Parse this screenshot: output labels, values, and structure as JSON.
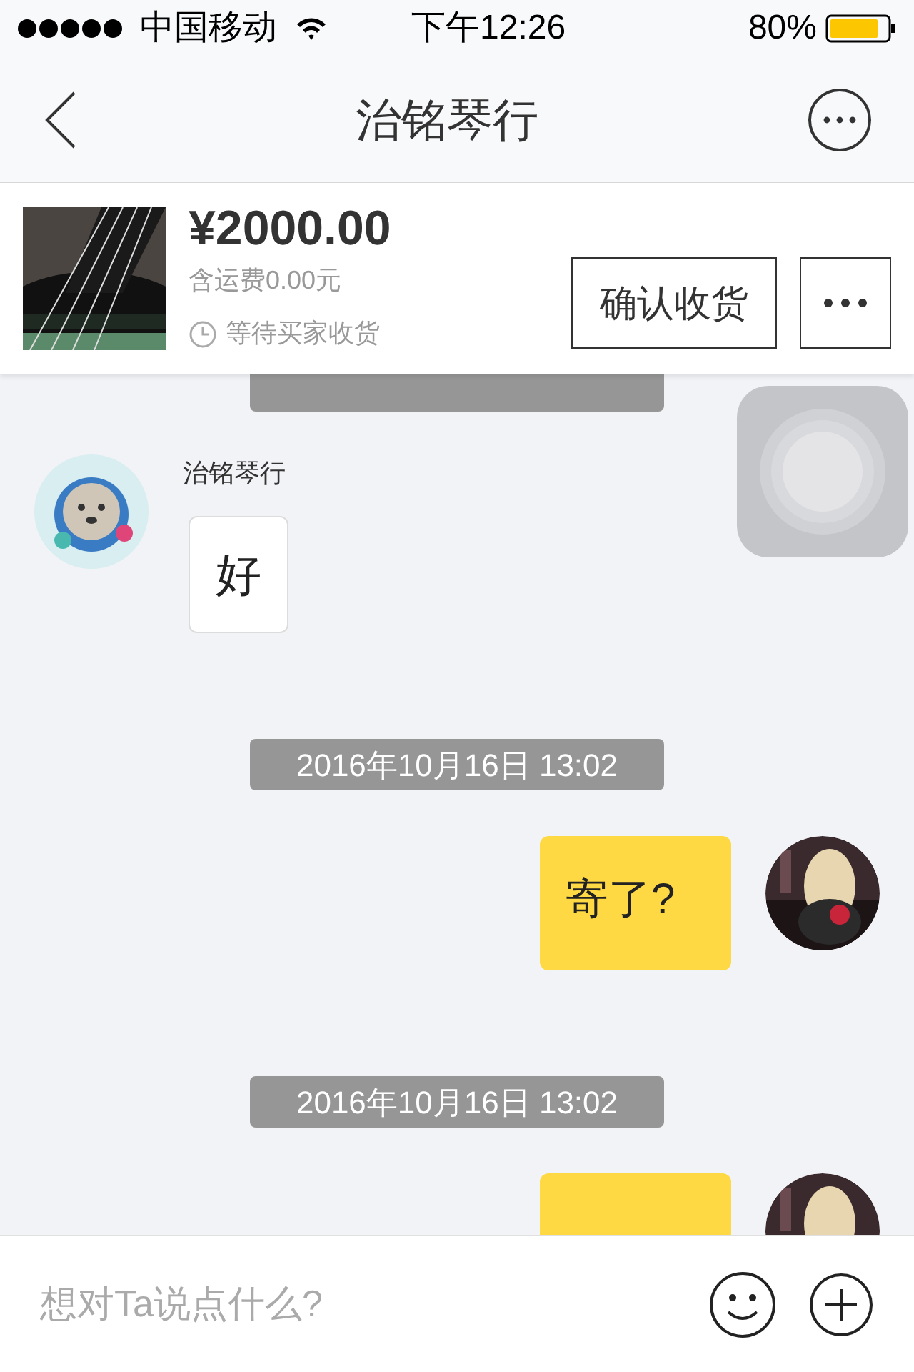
{
  "status_bar": {
    "carrier": "中国移动",
    "time": "下午12:26",
    "battery": "80%"
  },
  "nav": {
    "title": "治铭琴行"
  },
  "product": {
    "kind": "picture",
    "price": "¥2000.00",
    "shipping": "含运费0.00元",
    "status": "等待买家收货",
    "confirm_button": "确认收货"
  },
  "messages": [
    {
      "kind": "time"
    },
    {
      "kind": "incoming",
      "sender": "治铭琴行",
      "text": "好"
    },
    {
      "kind": "time",
      "text": "2016年10月16日 13:02"
    },
    {
      "kind": "outgoing",
      "text": "寄了?"
    },
    {
      "kind": "time",
      "text": "2016年10月16日 13:02"
    },
    {
      "kind": "outgoing"
    }
  ],
  "input": {
    "placeholder": "想对Ta说点什么?"
  }
}
